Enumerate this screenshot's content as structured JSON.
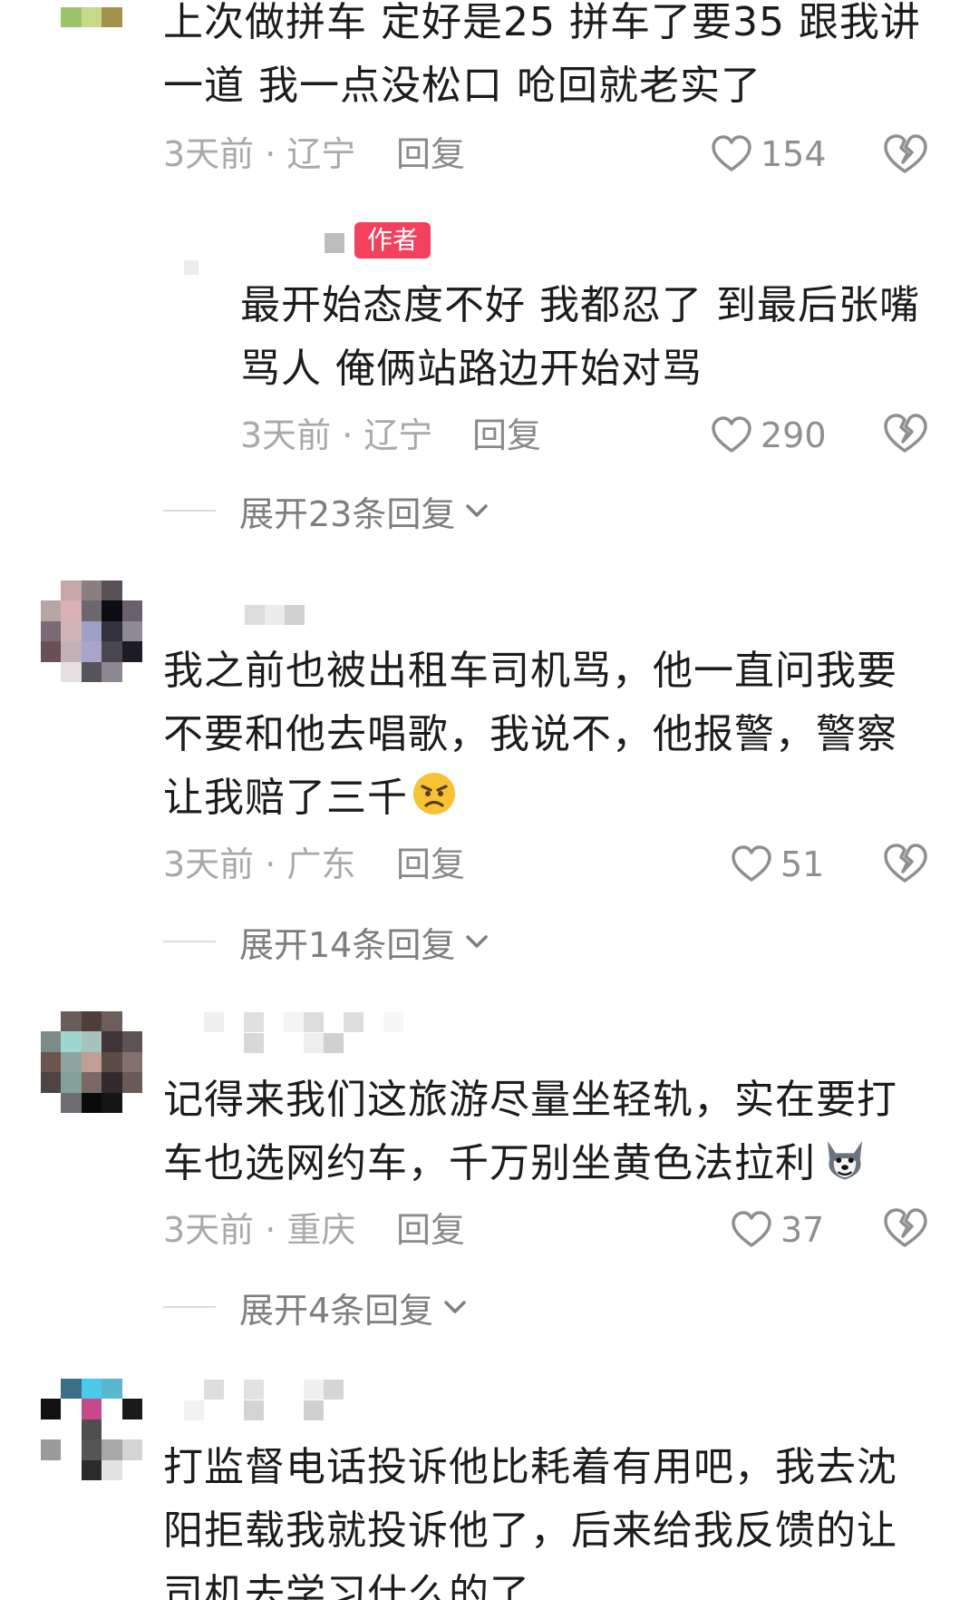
{
  "comments": [
    {
      "text": "上次做拼车 定好是25 拼车了要35 跟我讲\n一道 我一点没松口 呛回就老实了",
      "time_location": "3天前 · 辽宁",
      "reply_label": "回复",
      "likes": "154"
    },
    {
      "author_badge": "作者",
      "text": "最开始态度不好 我都忍了 到最后张嘴\n骂人 俺俩站路边开始对骂",
      "time_location": "3天前 · 辽宁",
      "reply_label": "回复",
      "likes": "290",
      "expand_label": "展开23条回复"
    },
    {
      "text": "我之前也被出租车司机骂，他一直问我要\n不要和他去唱歌，我说不，他报警，警察\n让我赔了三千",
      "emoji": "angry-face-emoji",
      "time_location": "3天前 · 广东",
      "reply_label": "回复",
      "likes": "51",
      "expand_label": "展开14条回复"
    },
    {
      "text": "记得来我们这旅游尽量坐轻轨，实在要打\n车也选网约车，千万别坐黄色法拉利",
      "emoji": "husky-dog-emoji",
      "time_location": "3天前 · 重庆",
      "reply_label": "回复",
      "likes": "37",
      "expand_label": "展开4条回复"
    },
    {
      "text": "打监督电话投诉他比耗着有用吧，我去沈\n阳拒载我就投诉他了，后来给我反馈的让\n司机去学习什么的了"
    }
  ],
  "colors": {
    "badge": "#f2405d",
    "text": "#1c1c1c",
    "meta": "#a9a9a9",
    "icon": "#8f8f8f"
  }
}
